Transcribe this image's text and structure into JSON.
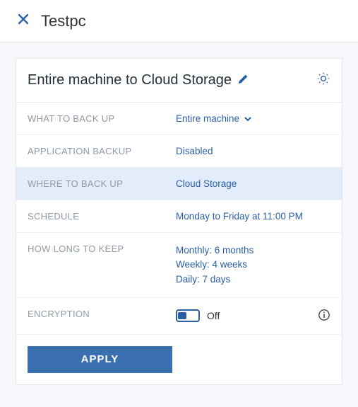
{
  "header": {
    "title": "Testpc"
  },
  "panel": {
    "title": "Entire machine to Cloud Storage"
  },
  "rows": {
    "what_label": "WHAT TO BACK UP",
    "what_value": "Entire machine",
    "app_label": "APPLICATION BACKUP",
    "app_value": "Disabled",
    "where_label": "WHERE TO BACK UP",
    "where_value": "Cloud Storage",
    "schedule_label": "SCHEDULE",
    "schedule_value": "Monday to Friday at 11:00 PM",
    "keep_label": "HOW LONG TO KEEP",
    "keep_line1": "Monthly: 6 months",
    "keep_line2": "Weekly: 4 weeks",
    "keep_line3": "Daily: 7 days",
    "enc_label": "ENCRYPTION",
    "enc_state": "Off"
  },
  "buttons": {
    "apply": "APPLY"
  },
  "colors": {
    "accent": "#2b5fa3",
    "highlight": "#e2ecfb"
  }
}
